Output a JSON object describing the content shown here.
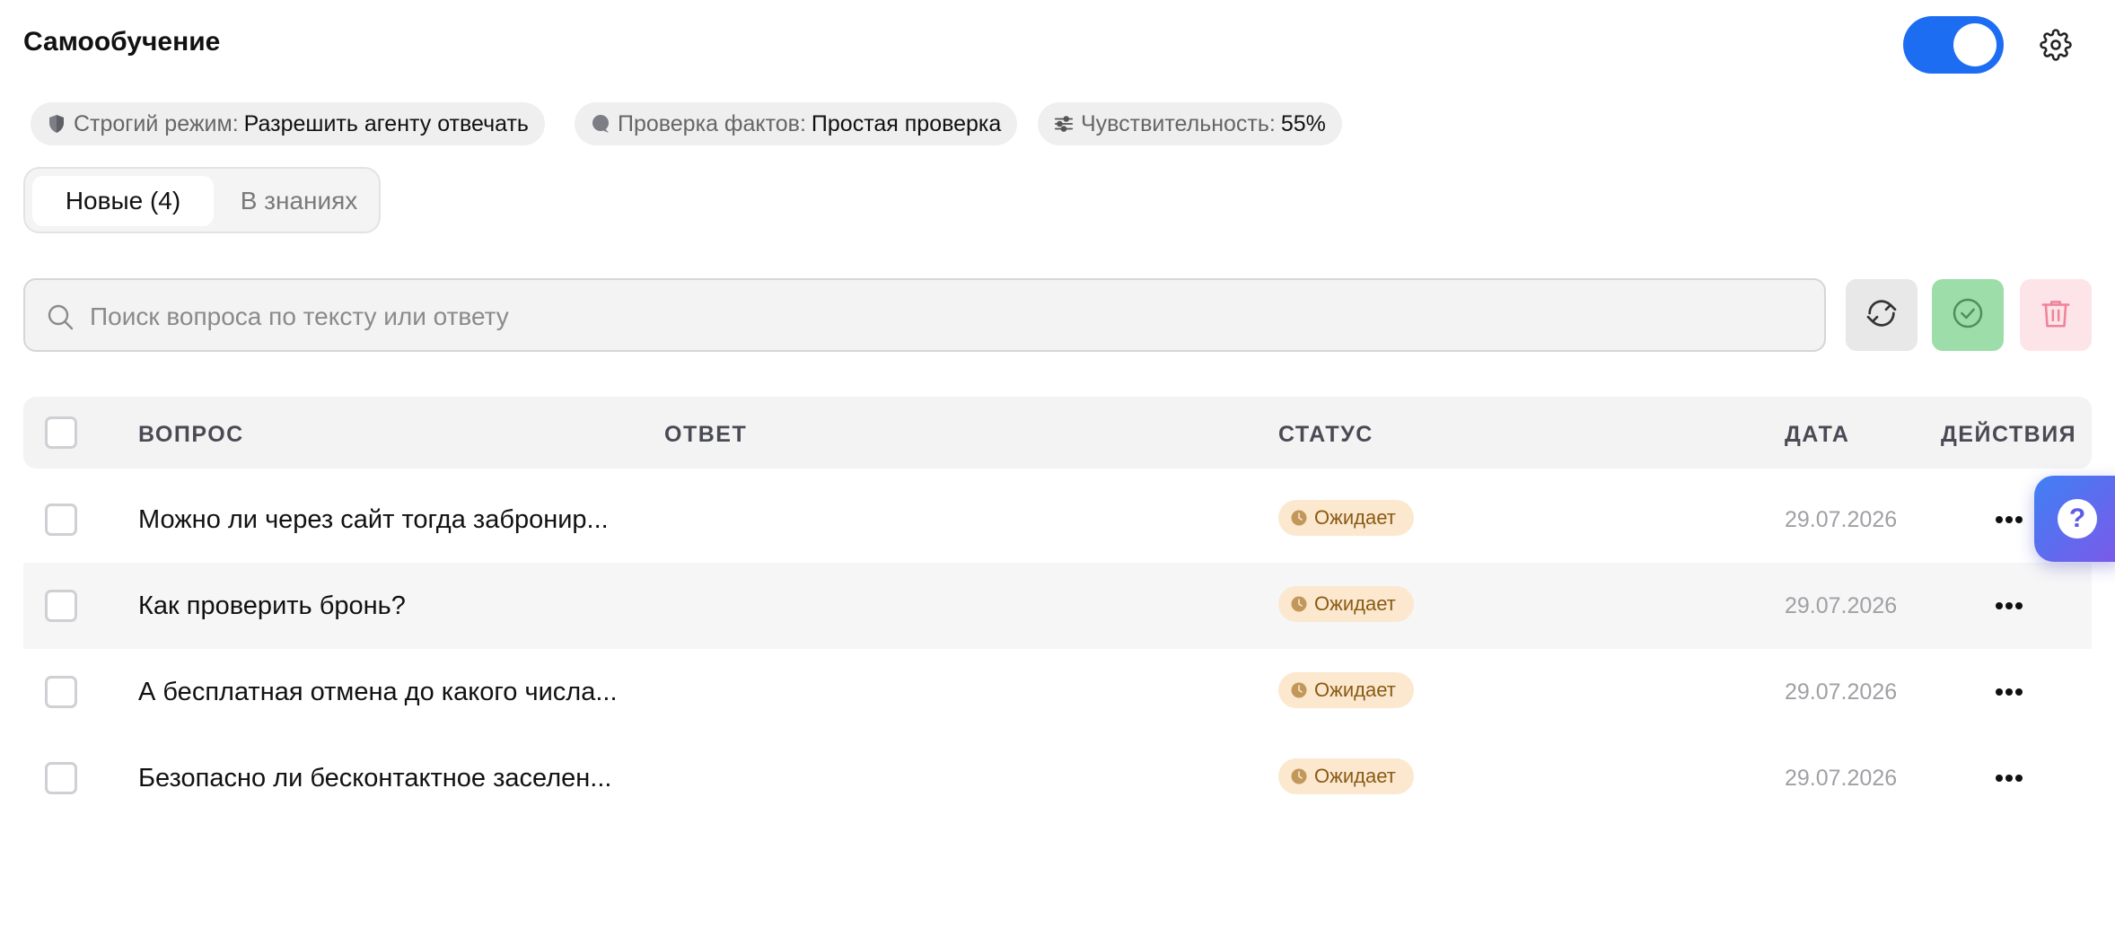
{
  "header": {
    "title": "Самообучение",
    "toggle_on": true
  },
  "chips": [
    {
      "icon": "shield-icon",
      "label": "Строгий режим:",
      "value": "Разрешить агенту отвечать"
    },
    {
      "icon": "chat-bubble-icon",
      "label": "Проверка фактов:",
      "value": "Простая проверка"
    },
    {
      "icon": "sliders-icon",
      "label": "Чувствительность:",
      "value": "55%"
    }
  ],
  "tabs": [
    {
      "label": "Новые (4)",
      "active": true
    },
    {
      "label": "В знаниях",
      "active": false
    }
  ],
  "search": {
    "placeholder": "Поиск вопроса по тексту или ответу",
    "value": ""
  },
  "toolbar": {
    "refresh_icon": "refresh-icon",
    "approve_icon": "check-circle-icon",
    "delete_icon": "trash-icon"
  },
  "table": {
    "headers": {
      "question": "ВОПРОС",
      "answer": "ОТВЕТ",
      "status": "СТАТУС",
      "date": "ДАТА",
      "actions": "ДЕЙСТВИЯ"
    },
    "rows": [
      {
        "question": "Можно ли через сайт тогда забронир...",
        "answer": "",
        "status": "Ожидает",
        "date": "29.07.2026"
      },
      {
        "question": "Как проверить бронь?",
        "answer": "",
        "status": "Ожидает",
        "date": "29.07.2026"
      },
      {
        "question": "А бесплатная отмена до какого числа...",
        "answer": "",
        "status": "Ожидает",
        "date": "29.07.2026"
      },
      {
        "question": "Безопасно ли бесконтактное заселен...",
        "answer": "",
        "status": "Ожидает",
        "date": "29.07.2026"
      }
    ]
  },
  "help": {
    "label": "?"
  },
  "colors": {
    "accent": "#1d6df2",
    "approve": "#9ddda9",
    "delete": "#fde4e8",
    "status_bg": "#fbe8cf",
    "status_text": "#8a5a14"
  }
}
